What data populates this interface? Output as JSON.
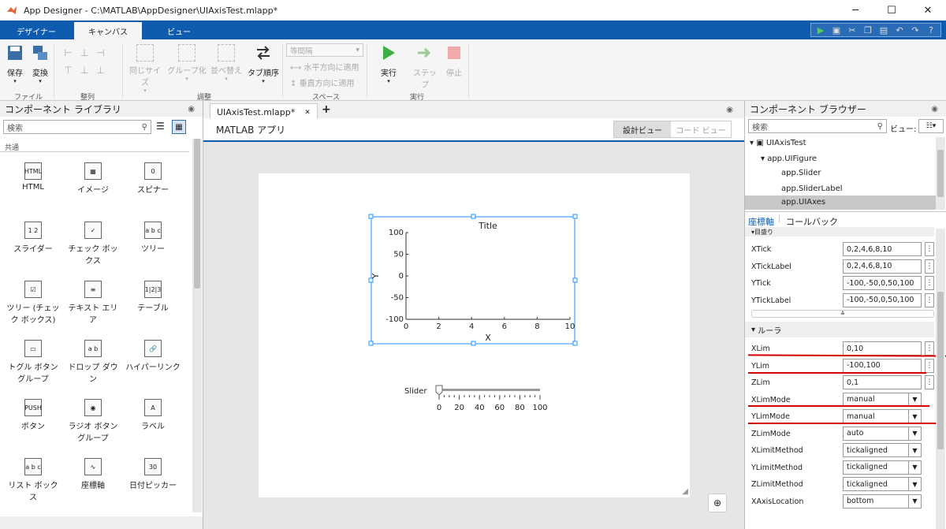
{
  "window": {
    "title": "App Designer - C:\\MATLAB\\AppDesigner\\UIAxisTest.mlapp*",
    "min": "─",
    "max": "☐",
    "close": "✕"
  },
  "tabs": [
    {
      "label": "デザイナー"
    },
    {
      "label": "キャンバス"
    },
    {
      "label": "ビュー"
    }
  ],
  "ribbon": {
    "save": "保存",
    "convert": "変換",
    "file_group": "ファイル",
    "align_group": "整列",
    "same_size": "同じサイズ",
    "group": "グループ化",
    "arrange": "並べ替え",
    "tab_order": "タブ順序",
    "adjust_group": "調整",
    "spacing_select": "等間隔",
    "apply_h": "水平方向に適用",
    "apply_v": "垂直方向に適用",
    "space_group": "スペース",
    "run": "実行",
    "step": "ステップ",
    "stop": "停止",
    "run_group": "実行"
  },
  "left_panel": {
    "title": "コンポーネント ライブラリ",
    "search_placeholder": "検索",
    "section": "共通",
    "components": [
      {
        "label": "HTML",
        "icon": "HTML"
      },
      {
        "label": "イメージ",
        "icon": "▦"
      },
      {
        "label": "スピナー",
        "icon": "0"
      },
      {
        "label": "スライダー",
        "icon": "1 2"
      },
      {
        "label": "チェック ボックス",
        "icon": "✓"
      },
      {
        "label": "ツリー",
        "icon": "a b c"
      },
      {
        "label": "ツリー (チェック ボックス)",
        "icon": "☑"
      },
      {
        "label": "テキスト エリア",
        "icon": "≡"
      },
      {
        "label": "テーブル",
        "icon": "1|2|3"
      },
      {
        "label": "トグル ボタン グループ",
        "icon": "▭"
      },
      {
        "label": "ドロップ ダウン",
        "icon": "a b"
      },
      {
        "label": "ハイパーリンク",
        "icon": "🔗"
      },
      {
        "label": "ボタン",
        "icon": "PUSH"
      },
      {
        "label": "ラジオ ボタン グループ",
        "icon": "◉"
      },
      {
        "label": "ラベル",
        "icon": "A"
      },
      {
        "label": "リスト ボックス",
        "icon": "a b c"
      },
      {
        "label": "座標軸",
        "icon": "∿"
      },
      {
        "label": "日付ピッカー",
        "icon": "30"
      }
    ]
  },
  "center": {
    "doc_tab": "UIAxisTest.mlapp*",
    "add_tab": "+",
    "app_name": "MATLAB アプリ",
    "design_view": "設計ビュー",
    "code_view": "コード ビュー",
    "axes": {
      "title": "Title",
      "xlabel": "X",
      "ylabel": "Y",
      "xticks": [
        "0",
        "2",
        "4",
        "6",
        "8",
        "10"
      ],
      "yticks": [
        "100",
        "50",
        "0",
        "-50",
        "-100"
      ]
    },
    "slider": {
      "label": "Slider",
      "ticks": [
        "0",
        "20",
        "40",
        "60",
        "80",
        "100"
      ],
      "value": 0
    }
  },
  "right_panel": {
    "title": "コンポーネント ブラウザー",
    "search_placeholder": "検索",
    "view_label": "ビュー:",
    "tree": [
      {
        "label": "UIAxisTest"
      },
      {
        "label": "app.UIFigure"
      },
      {
        "label": "app.Slider"
      },
      {
        "label": "app.SliderLabel"
      },
      {
        "label": "app.UIAxes"
      }
    ],
    "tabs": {
      "props": "座標軸",
      "callbacks": "コールバック"
    },
    "section_ticks": "目盛り",
    "section_ruler": "ルーラ",
    "props": [
      {
        "label": "XTick",
        "value": "0,2,4,6,8,10"
      },
      {
        "label": "XTickLabel",
        "value": "0,2,4,6,8,10"
      },
      {
        "label": "YTick",
        "value": "-100,-50,0,50,100"
      },
      {
        "label": "YTickLabel",
        "value": "-100,-50,0,50,100"
      },
      {
        "label": "XLim",
        "value": "0,10"
      },
      {
        "label": "YLim",
        "value": "-100,100"
      },
      {
        "label": "ZLim",
        "value": "0,1"
      },
      {
        "label": "XLimMode",
        "value": "manual"
      },
      {
        "label": "YLimMode",
        "value": "manual"
      },
      {
        "label": "ZLimMode",
        "value": "auto"
      },
      {
        "label": "XLimitMethod",
        "value": "tickaligned"
      },
      {
        "label": "YLimitMethod",
        "value": "tickaligned"
      },
      {
        "label": "ZLimitMethod",
        "value": "tickaligned"
      },
      {
        "label": "XAxisLocation",
        "value": "bottom"
      }
    ]
  }
}
